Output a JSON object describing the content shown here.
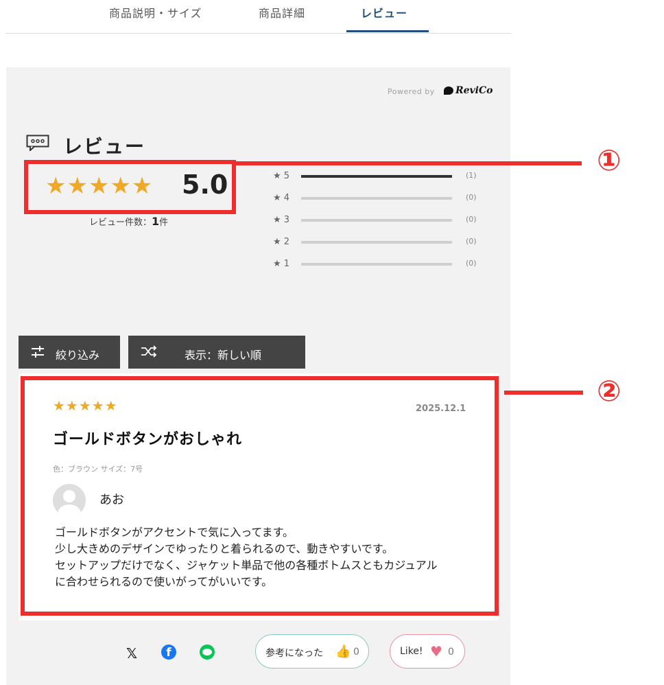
{
  "tabs": {
    "items": [
      "商品説明・サイズ",
      "商品詳細",
      "レビュー"
    ],
    "active": "レビュー"
  },
  "powered_by": {
    "label": "Powered by",
    "brand": "ReviCo"
  },
  "summary": {
    "heading": "レビュー",
    "stars": "★★★★★",
    "rating": "5.0",
    "count_label": "レビュー件数：",
    "count_value": "1",
    "count_unit": "件",
    "distribution": [
      {
        "label": "★ 5",
        "count": "(1)",
        "fraction": 1.0
      },
      {
        "label": "★ 4",
        "count": "(0)",
        "fraction": 0
      },
      {
        "label": "★ 3",
        "count": "(0)",
        "fraction": 0
      },
      {
        "label": "★ 2",
        "count": "(0)",
        "fraction": 0
      },
      {
        "label": "★ 1",
        "count": "(0)",
        "fraction": 0
      }
    ]
  },
  "controls": {
    "filter_label": "絞り込み",
    "sort_label": "表示：新しい順"
  },
  "review": {
    "stars": "★★★★★",
    "rating": 5,
    "date": "2025.12.1",
    "title": "ゴールドボタンがおしゃれ",
    "variant": "色：ブラウン サイズ：7号",
    "author": "あお",
    "body_lines": [
      "ゴールドボタンがアクセントで気に入ってます。",
      "少し大きめのデザインでゆったりと着られるので、動きやすいです。",
      "セットアップだけでなく、ジャケット単品で他の各種ボトムスともカジュアル",
      "に合わせられるので使いがってがいいです。"
    ]
  },
  "actions": {
    "helpful_label": "参考になった",
    "helpful_count": "0",
    "like_label": "Like!",
    "like_count": "0"
  },
  "callouts": [
    "①",
    "②"
  ],
  "colors": {
    "star": "#f0a926",
    "accent_tab": "#1f4f7a",
    "annotation_red": "#ee2d2d",
    "panel_bg": "#f2f2f2",
    "button_bg": "#444444"
  }
}
